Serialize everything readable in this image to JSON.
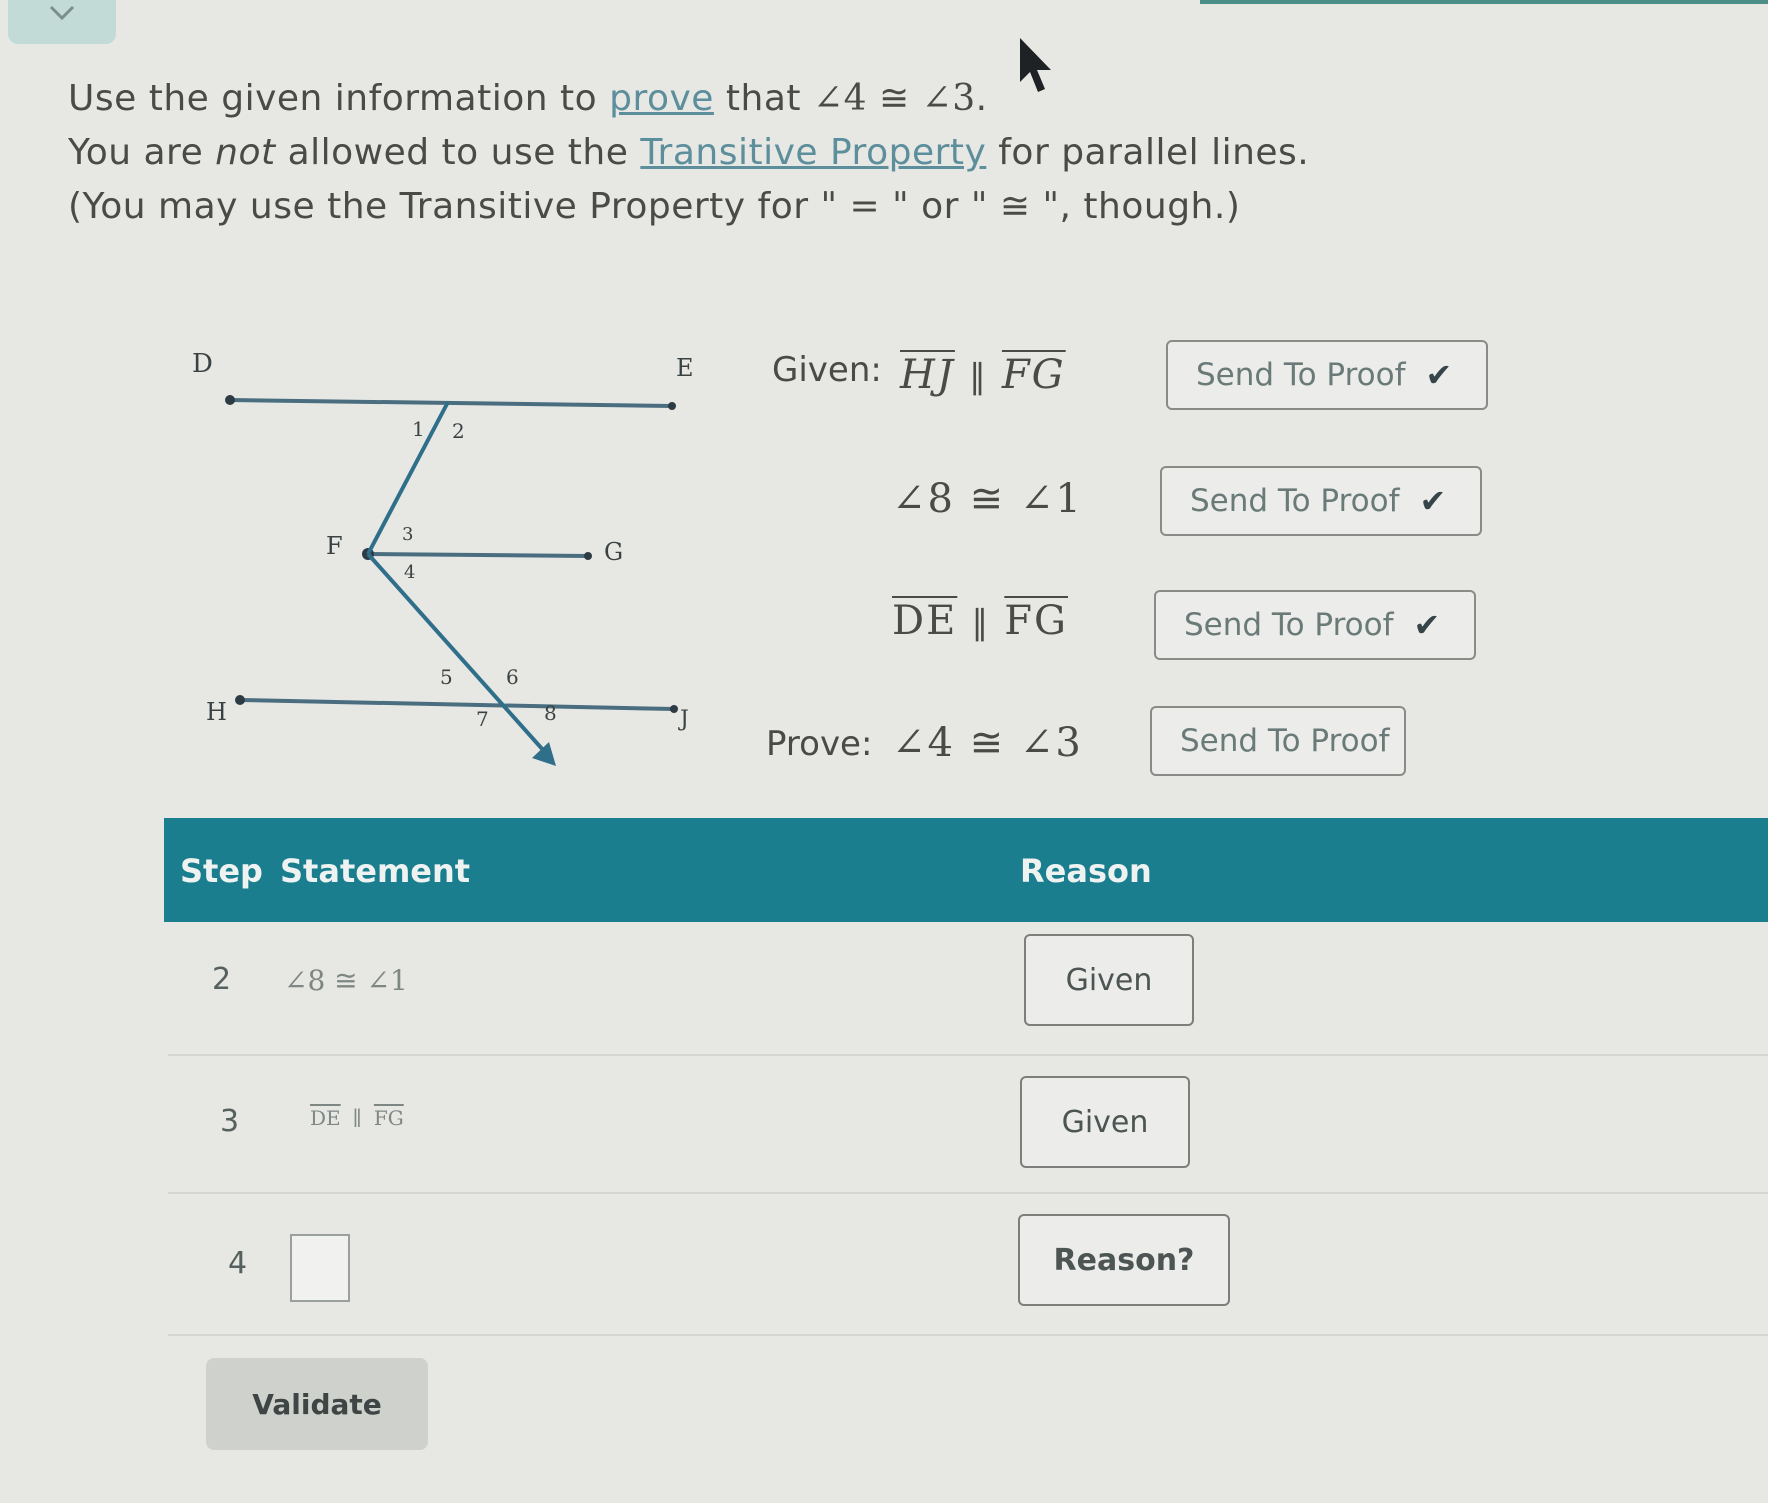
{
  "instructions": {
    "line1_prefix": "Use the given information to ",
    "line1_link": "prove",
    "line1_mid": " that ",
    "line1_math_a": "∠4",
    "line1_cong": "≅",
    "line1_math_b": "∠3",
    "line1_end": ".",
    "line2_prefix": "You are ",
    "line2_not": "not",
    "line2_mid": " allowed to use the ",
    "line2_link": "Transitive Property",
    "line2_end": " for parallel lines.",
    "line3_prefix": "(You may use the Transitive Property for ",
    "line3_eq": "\" = \"",
    "line3_or": " or ",
    "line3_cong": "\" ≅ \"",
    "line3_end": ", though.)"
  },
  "diagram": {
    "points": [
      "D",
      "E",
      "F",
      "G",
      "H",
      "J"
    ],
    "angles": [
      "1",
      "2",
      "3",
      "4",
      "5",
      "6",
      "7",
      "8"
    ]
  },
  "given": {
    "label": "Given:",
    "s1_a": "HJ",
    "s1_b": "FG",
    "s1_rel": "∥",
    "s2": "∠8 ≅ ∠1",
    "s3_a": "DE",
    "s3_b": "FG",
    "s3_rel": "∥"
  },
  "prove": {
    "label": "Prove:",
    "statement": "∠4 ≅ ∠3"
  },
  "send_button_label": "Send To Proof",
  "check_icon": "✔",
  "table": {
    "headers": {
      "step": "Step",
      "statement": "Statement",
      "reason": "Reason"
    },
    "rows": [
      {
        "step": "2",
        "statement": "∠8 ≅ ∠1",
        "reason": "Given"
      },
      {
        "step": "3",
        "stmt_a": "DE",
        "stmt_rel": "∥",
        "stmt_b": "FG",
        "reason": "Given"
      },
      {
        "step": "4",
        "statement": "",
        "reason": "Reason?"
      }
    ]
  },
  "validate_label": "Validate"
}
